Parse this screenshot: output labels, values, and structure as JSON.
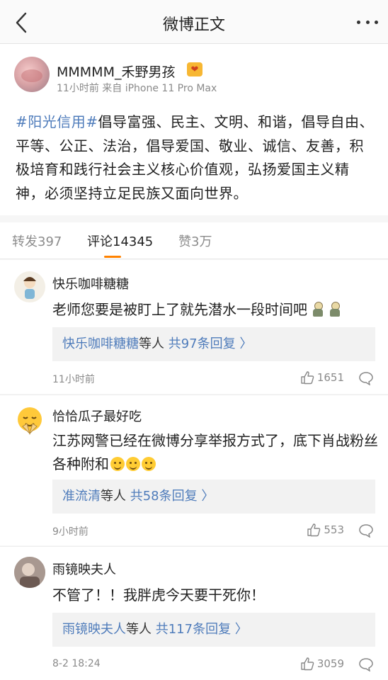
{
  "navbar": {
    "title": "微博正文"
  },
  "post": {
    "username": "MMMMM_禾野男孩",
    "vip_badge": "❤",
    "meta": "11小时前 来自 iPhone 11 Pro Max",
    "hashtag": "#阳光信用#",
    "body": "倡导富强、民主、文明、和谐，倡导自由、平等、公正、法治，倡导爱国、敬业、诚信、友善，积极培育和践行社会主义核心价值观，弘扬爱国主义精神，必须坚持立足民族又面向世界。"
  },
  "tabs": [
    {
      "label": "转发397"
    },
    {
      "label": "评论14345"
    },
    {
      "label": "赞3万"
    }
  ],
  "comments": [
    {
      "name": "快乐咖啡糖糖",
      "text": "老师您要是被盯上了就先潜水一段时间吧",
      "reply_name": "快乐咖啡糖糖",
      "reply_suffix": "等人",
      "reply_count": "共97条回复 〉",
      "time": "11小时前",
      "likes": "1651"
    },
    {
      "name": "恰恰瓜子最好吃",
      "text": "江苏网警已经在微博分享举报方式了，底下肖战粉丝各种附和",
      "reply_name": "准流清",
      "reply_suffix": "等人",
      "reply_count": "共58条回复 〉",
      "time": "9小时前",
      "likes": "553"
    },
    {
      "name": "雨镜映夫人",
      "text": "不管了！！我胖虎今天要干死你！",
      "reply_name": "雨镜映夫人",
      "reply_suffix": "等人",
      "reply_count": "共117条回复 〉",
      "time": "8-2 18:24",
      "likes": "3059"
    }
  ]
}
